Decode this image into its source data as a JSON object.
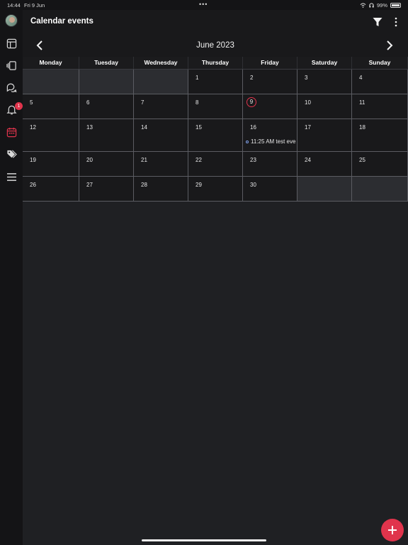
{
  "statusbar": {
    "time": "14:44",
    "date": "Fri 9 Jun",
    "battery": "99%"
  },
  "header": {
    "title": "Calendar events"
  },
  "calendar": {
    "month_label": "June 2023",
    "weekdays": [
      "Monday",
      "Tuesday",
      "Wednesday",
      "Thursday",
      "Friday",
      "Saturday",
      "Sunday"
    ],
    "weeks": [
      [
        "",
        "",
        "",
        "1",
        "2",
        "3",
        "4"
      ],
      [
        "5",
        "6",
        "7",
        "8",
        "9",
        "10",
        "11"
      ],
      [
        "12",
        "13",
        "14",
        "15",
        "16",
        "17",
        "18"
      ],
      [
        "19",
        "20",
        "21",
        "22",
        "23",
        "24",
        "25"
      ],
      [
        "26",
        "27",
        "28",
        "29",
        "30",
        "",
        ""
      ]
    ],
    "today": "9",
    "events": [
      {
        "day": "16",
        "label": "11:25 AM test eve"
      }
    ]
  },
  "sidebar": {
    "badge_count": "1",
    "items": [
      "avatar",
      "dashboard-icon",
      "cards-icon",
      "chat-icon",
      "bell-icon",
      "calendar-icon",
      "tags-icon",
      "menu-icon"
    ]
  },
  "colors": {
    "accent": "#e0344c",
    "background": "#1f2023",
    "cell": "#19191b",
    "empty_cell": "#2c2d31",
    "event_dot": "#7fa0e8"
  }
}
